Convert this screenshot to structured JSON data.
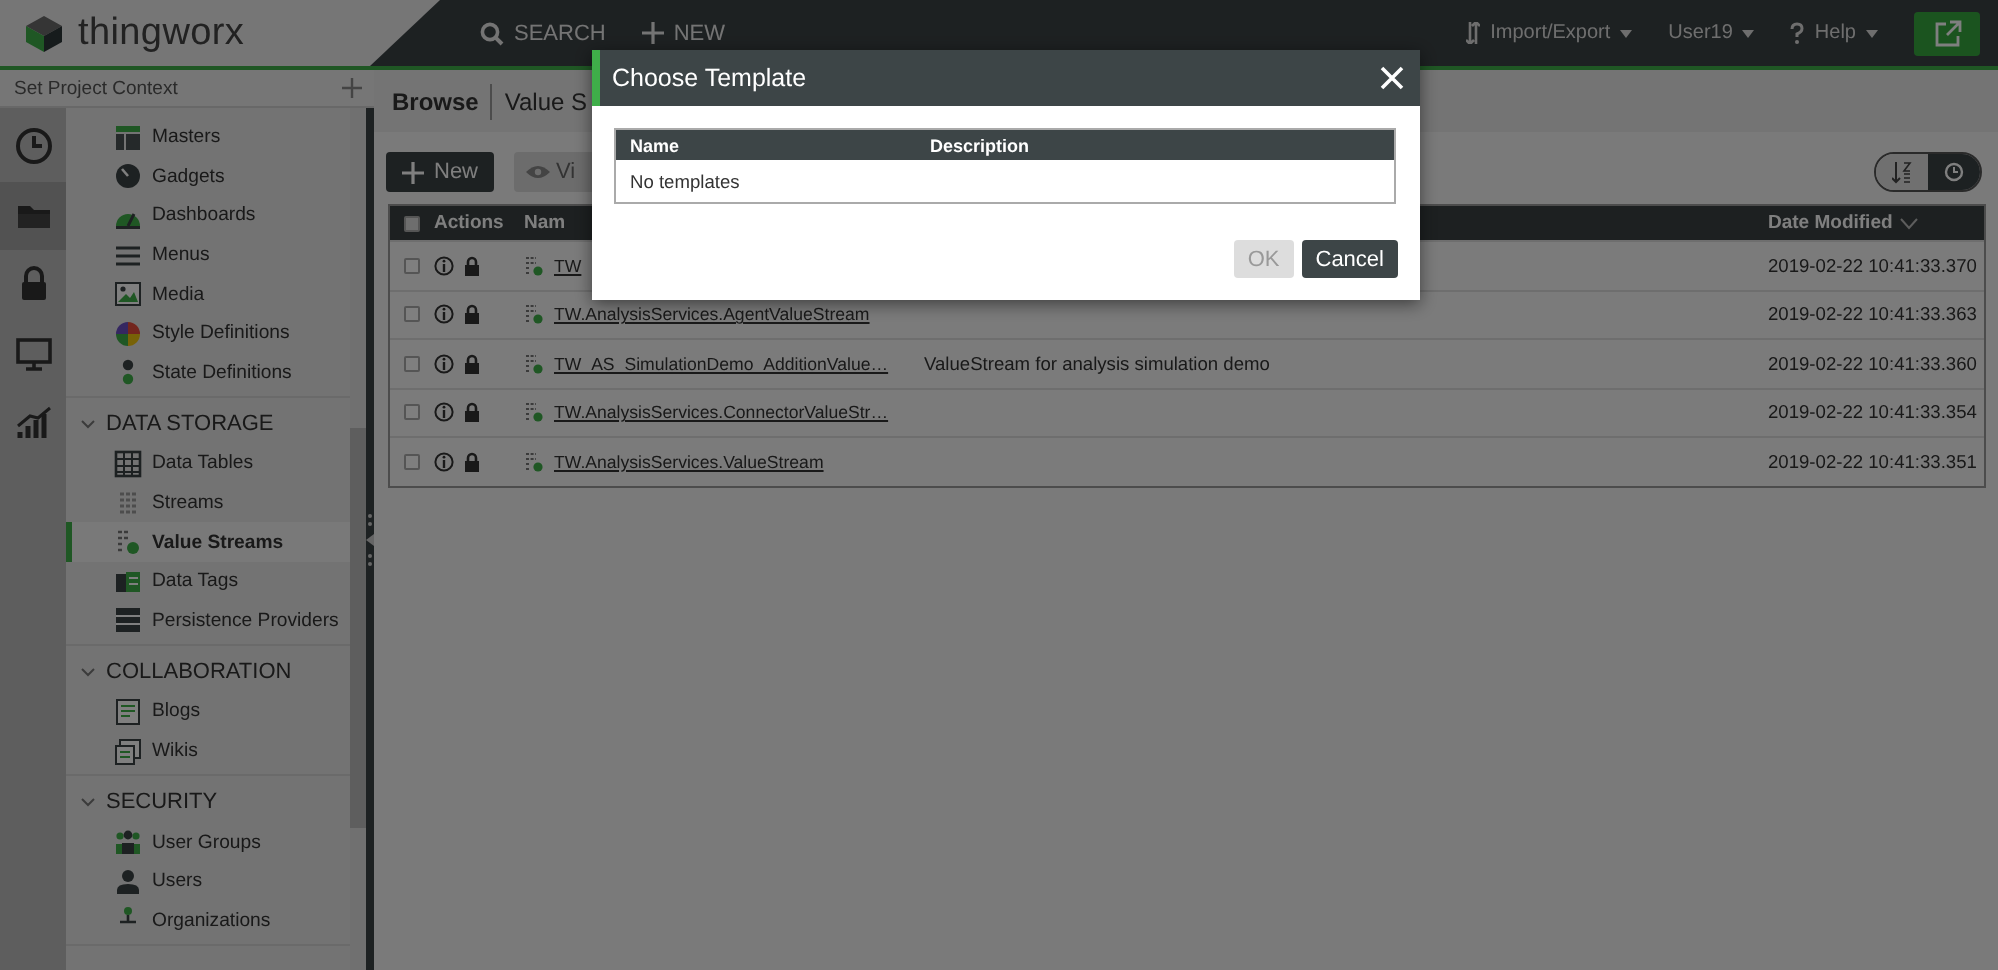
{
  "header": {
    "brand": "thingworx",
    "search": "SEARCH",
    "new": "NEW",
    "menus": [
      {
        "label": "Import/Export",
        "kind": "transfer"
      },
      {
        "label": "User19",
        "kind": "plain"
      },
      {
        "label": "Help",
        "kind": "help"
      }
    ]
  },
  "sidebar": {
    "project_context": "Set Project Context",
    "rail": [
      {
        "selected": false
      },
      {
        "selected": true
      },
      {
        "selected": false
      },
      {
        "selected": false
      },
      {
        "selected": false
      }
    ],
    "sections": [
      {
        "items": [
          {
            "label": "Masters",
            "selected": false
          },
          {
            "label": "Gadgets",
            "selected": false
          },
          {
            "label": "Dashboards",
            "selected": false
          },
          {
            "label": "Menus",
            "selected": false
          },
          {
            "label": "Media",
            "selected": false
          },
          {
            "label": "Style Definitions",
            "selected": false
          },
          {
            "label": "State Definitions",
            "selected": false
          }
        ]
      },
      {
        "title": "DATA STORAGE",
        "expanded": true,
        "items": [
          {
            "label": "Data Tables",
            "selected": false
          },
          {
            "label": "Streams",
            "selected": false
          },
          {
            "label": "Value Streams",
            "selected": true
          },
          {
            "label": "Data Tags",
            "selected": false
          },
          {
            "label": "Persistence Providers",
            "selected": false
          }
        ]
      },
      {
        "title": "COLLABORATION",
        "expanded": true,
        "items": [
          {
            "label": "Blogs",
            "selected": false
          },
          {
            "label": "Wikis",
            "selected": false
          }
        ]
      },
      {
        "title": "SECURITY",
        "expanded": true,
        "items": [
          {
            "label": "User Groups",
            "selected": false
          },
          {
            "label": "Users",
            "selected": false
          },
          {
            "label": "Organizations",
            "selected": false
          }
        ]
      }
    ]
  },
  "browser": {
    "breadcrumb": [
      "Browse",
      "Value S"
    ],
    "buttons": [
      {
        "label": "New",
        "kind": "new"
      },
      {
        "label": "Vi",
        "kind": "view"
      }
    ],
    "sort_modes": [
      {
        "selected": false
      },
      {
        "selected": true
      }
    ],
    "table": {
      "select_all": {
        "checked": false
      },
      "columns": [
        "Actions",
        "Nam",
        "Date Modified"
      ],
      "rows": [
        {
          "name": "TW",
          "description": "",
          "date": "2019-02-22 10:41:33.370",
          "checked": false
        },
        {
          "name": "TW.AnalysisServices.AgentValueStream",
          "description": "",
          "date": "2019-02-22 10:41:33.363",
          "checked": false
        },
        {
          "name": "TW_AS_SimulationDemo_AdditionValue…",
          "description": "ValueStream for analysis simulation demo",
          "date": "2019-02-22 10:41:33.360",
          "checked": false
        },
        {
          "name": "TW.AnalysisServices.ConnectorValueStr…",
          "description": "",
          "date": "2019-02-22 10:41:33.354",
          "checked": false
        },
        {
          "name": "TW.AnalysisServices.ValueStream",
          "description": "",
          "date": "2019-02-22 10:41:33.351",
          "checked": false
        }
      ]
    }
  },
  "dialog": {
    "title": "Choose Template",
    "columns": [
      "Name",
      "Description"
    ],
    "empty_message": "No templates",
    "buttons": [
      {
        "label": "OK",
        "disabled": true
      },
      {
        "label": "Cancel",
        "disabled": false
      }
    ]
  }
}
